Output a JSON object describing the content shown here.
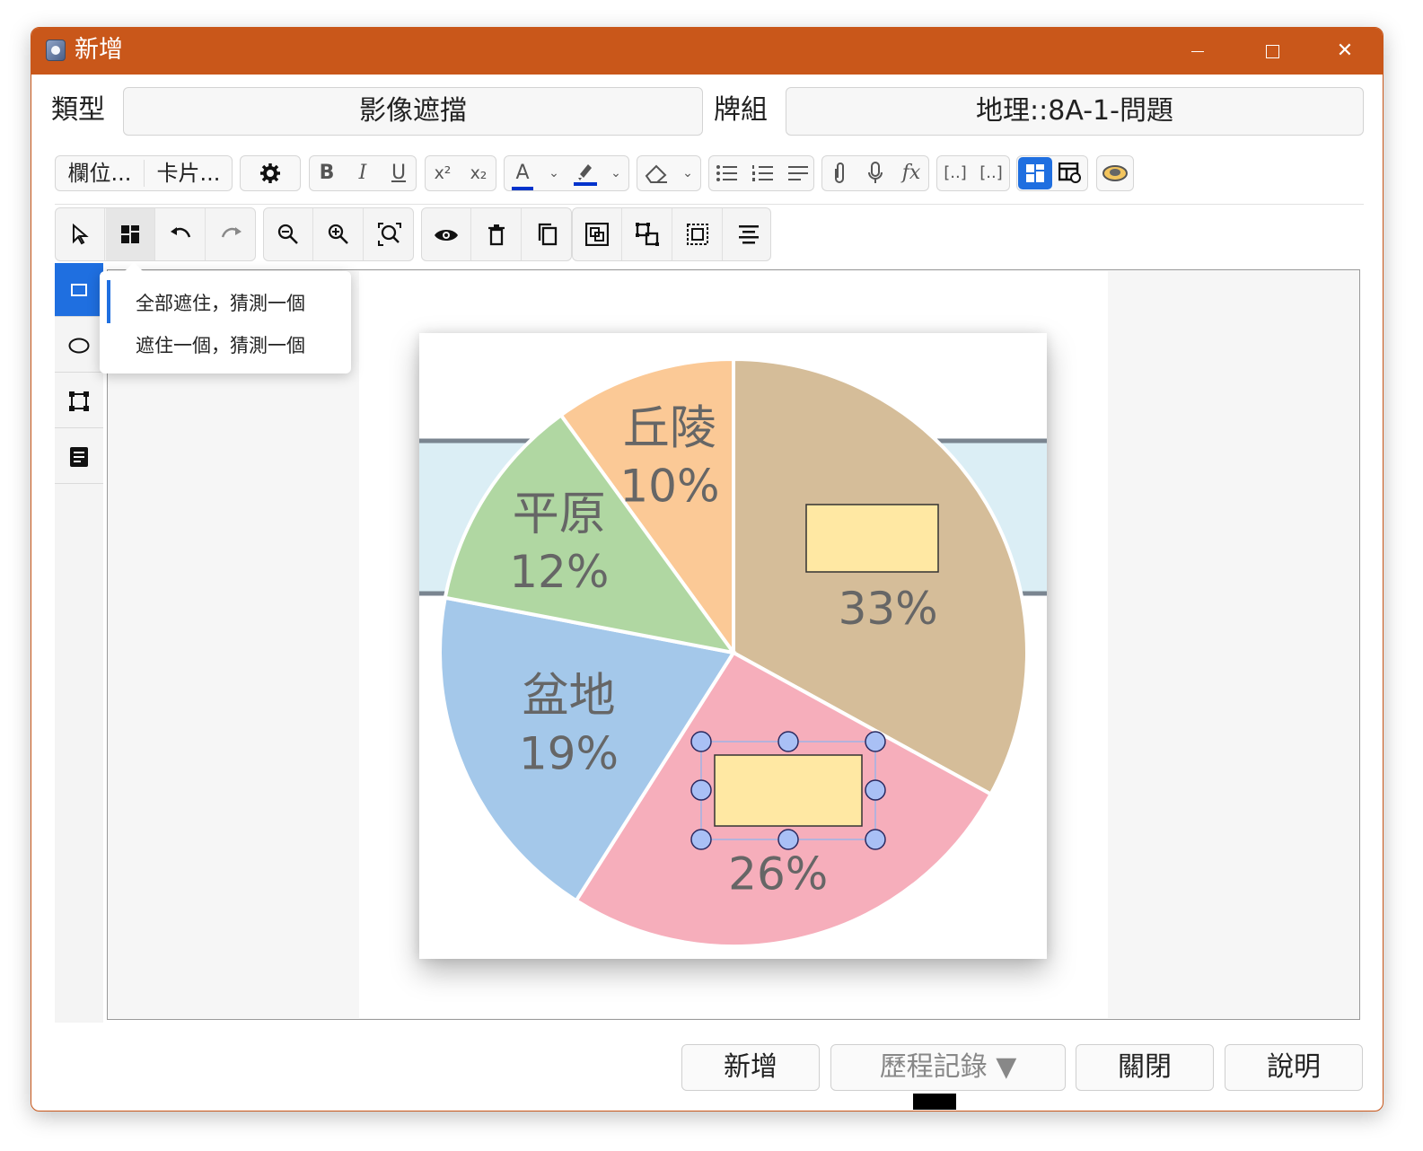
{
  "window": {
    "title": "新增"
  },
  "header": {
    "type_label": "類型",
    "type_value": "影像遮擋",
    "deck_label": "牌組",
    "deck_value": "地理::8A-1-問題"
  },
  "format_toolbar": {
    "fields_label": "欄位...",
    "cards_label": "卡片...",
    "bold": "B",
    "italic": "I",
    "underline": "U",
    "superscript": "x²",
    "subscript": "x₂",
    "font_color_glyph": "A",
    "text_color": "#0033cc",
    "highlight_color": "#0033cc",
    "formula": "fx"
  },
  "occlusion_menu": {
    "items": [
      "全部遮住，猜測一個",
      "遮住一個，猜測一個"
    ],
    "selected_index": 0
  },
  "chart_data": {
    "type": "pie",
    "slices": [
      {
        "label": "丘陵",
        "value": 10,
        "value_label": "10%",
        "color": "#fbc996"
      },
      {
        "label": "",
        "value": 33,
        "value_label": "33%",
        "color": "#d5bd99"
      },
      {
        "label": "",
        "value": 26,
        "value_label": "26%",
        "color": "#f6aebb"
      },
      {
        "label": "盆地",
        "value": 19,
        "value_label": "19%",
        "color": "#a4c8ea"
      },
      {
        "label": "平原",
        "value": 12,
        "value_label": "12%",
        "color": "#b0d7a2"
      }
    ],
    "mask_color": "#ffe8a3"
  },
  "footer": {
    "add_label": "新增",
    "history_label": "歷程記錄 ▼",
    "close_label": "關閉",
    "help_label": "說明"
  },
  "colors": {
    "titlebar": "#c9571a",
    "accent": "#1f6fe0"
  }
}
